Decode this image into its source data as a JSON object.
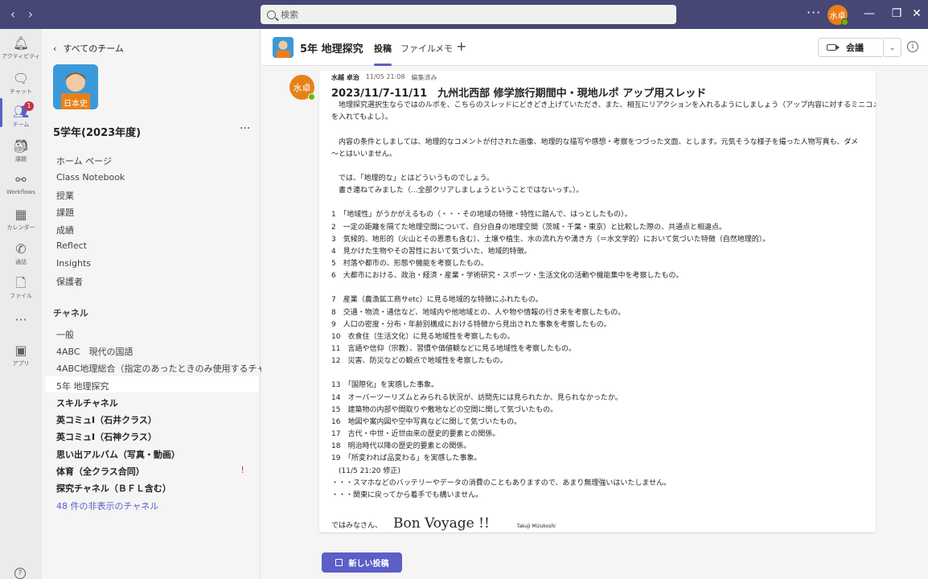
{
  "titlebar": {
    "search_placeholder": "検索",
    "more": "···",
    "avatar_text": "水卓"
  },
  "rail": {
    "items": [
      {
        "label": "アクティビティ",
        "icon": "bell-icon"
      },
      {
        "label": "チャット",
        "icon": "chat-icon"
      },
      {
        "label": "チーム",
        "icon": "teams-icon",
        "badge": "1"
      },
      {
        "label": "課題",
        "icon": "assignments-icon"
      },
      {
        "label": "Workflows",
        "icon": "workflows-icon"
      },
      {
        "label": "カレンダー",
        "icon": "calendar-icon"
      },
      {
        "label": "通話",
        "icon": "phone-icon"
      },
      {
        "label": "ファイル",
        "icon": "file-icon"
      },
      {
        "label": "",
        "icon": "more-icon"
      },
      {
        "label": "アプリ",
        "icon": "apps-icon"
      }
    ],
    "help": "?"
  },
  "panel": {
    "back_label": "すべてのチーム",
    "team_name": "5学年(2023年度)",
    "team_more": "···",
    "nav": [
      "ホーム ページ",
      "Class Notebook",
      "授業",
      "課題",
      "成績",
      "Reflect",
      "Insights",
      "保護者"
    ],
    "channels_heading": "チャネル",
    "channels": [
      {
        "name": "一般",
        "bold": false
      },
      {
        "name": "4ABC　現代の国語",
        "bold": false
      },
      {
        "name": "4ABC地理総合（指定のあったときのみ使用するチャネ...",
        "bold": false
      },
      {
        "name": "5年 地理探究",
        "bold": false
      },
      {
        "name": "スキルチャネル",
        "bold": true
      },
      {
        "name": "英コミュⅠ（石井クラス）",
        "bold": true
      },
      {
        "name": "英コミュⅠ（石神クラス）",
        "bold": true
      },
      {
        "name": "思い出アルバム（写真・動画）",
        "bold": true
      },
      {
        "name": "体育（全クラス合同）",
        "bold": true
      },
      {
        "name": "探究チャネル（ＢＦＬ含む）",
        "bold": true
      }
    ],
    "hidden_channels": "48 件の非表示のチャネル"
  },
  "header": {
    "title": "5年 地理探究",
    "tabs": [
      "投稿",
      "ファイル",
      "メモ"
    ],
    "add": "+",
    "meet_label": "会議",
    "info": "i",
    "more": "···"
  },
  "post": {
    "avatar_text": "水卓",
    "author": "水越 卓治",
    "timestamp": "11/05 21:08",
    "edited": "編集済み",
    "title": "2023/11/7-11/11　九州北西部 修学旅行期間中・現地ルポ アップ用スレッド",
    "lines": [
      "　地理探究選択生ならではのルポを、こちらのスレッドにどきどき上げていただき、また、相互にリアクションを入れるようにしましょう（アップ内容に対するミニコメント",
      "を入れてもよし）。",
      "",
      "　内容の条件としましては、地理的なコメントが付された画像、地理的な描写や感想・考察をつづった文面、とします。元気そうな様子を撮った人物写真も、ダメ",
      "〜とはいいません。",
      "",
      "　では、「地理的な」とはどういうものでしょう。",
      "　書き連ねてみました（...全部クリアしましょうということではないっす。）。",
      "",
      "1　「地域性」がうかがえるもの（・・・その地域の特徴・特性に踏んで、はっとしたもの）。",
      "2　一定の距離を隔てた地理空間について、自分自身の地理空間（茨城・千葉・東京）と比較した際の、共通点と相違点。",
      "3　気候的、地形的（火山とその恩恵も含む）、土壌や植生、水の流れ方や湧き方（＝水文学的）において気づいた特徴（自然地理的）。",
      "4　見かけた生物やその習性において気づいた、地域的特徴。",
      "5　村落や都市の、形態や機能を考察したもの。",
      "6　大都市における、政治・経済・産業・学術研究・スポーツ・生活文化の活動や機能集中を考察したもの。",
      "",
      "7　産業（農漁鉱工商サetc）に見る地域的な特徴にふれたもの。",
      "8　交通・物流・通信など、地域内や他地域との、人や物や情報の行き来を考察したもの。",
      "9　人口の密度・分布・年齢別構成における特徴から見出された事象を考察したもの。",
      "10　衣食住（生活文化）に見る地域性を考察したもの。",
      "11　言語や信仰（宗教）、習慣や価値観などに見る地域性を考察したもの。",
      "12　災害、防災などの観点で地域性を考察したもの。",
      "",
      "13　「国際化」を実感した事象。",
      "14　オーバーツーリズムとみられる状況が、訪問先には見られたか、見られなかったか。",
      "15　建築物の内部や間取りや敷地などの空間に関して気づいたもの。",
      "16　地図や案内図や空中写真などに関して気づいたもの。",
      "17　古代・中世・近世由来の歴史的要素との関係。",
      "18　明治時代以降の歴史的要素との関係。",
      "19　「所変われば品変わる」を実感した事象。",
      "　(11/5 21:20 修正)",
      "・・・スマホなどのバッテリーやデータの消費のこともありますので、あまり無理強いはいたしません。",
      "・・・関東に戻ってから着手でも構いません。"
    ],
    "closing_prefix": "ではみなさん、",
    "closing_big": "Bon Voyage !!",
    "signature": "Takuji Mizukoshi"
  },
  "new_post_label": "新しい投稿",
  "colors": {
    "titlebar": "#464775",
    "accent": "#5b5fc7",
    "avatar": "#e8801a",
    "presence": "#6bb700",
    "badge": "#c4314b"
  }
}
